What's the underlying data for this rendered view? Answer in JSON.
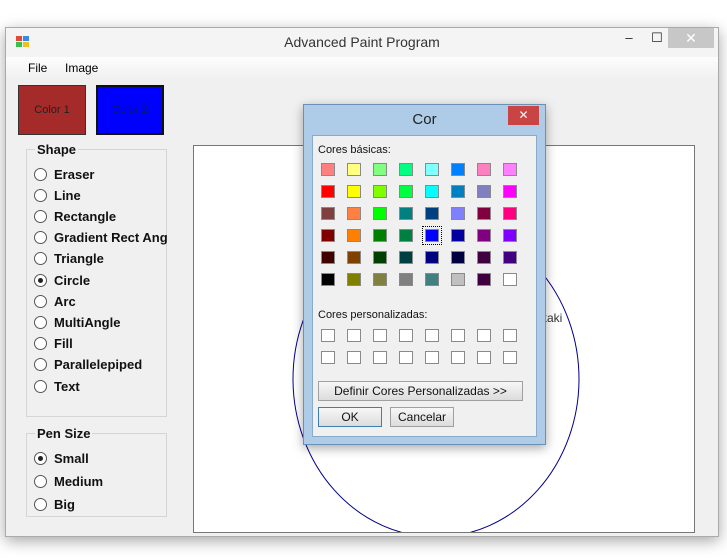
{
  "window": {
    "title": "Advanced Paint Program",
    "minimize_glyph": "–",
    "maximize_glyph": "☐",
    "close_glyph": "✕"
  },
  "menu": [
    "File",
    "Image"
  ],
  "colors": {
    "color1": {
      "label": "Color 1",
      "value": "#a52a2a"
    },
    "color2": {
      "label": "Color 2",
      "value": "#0000ff"
    }
  },
  "shape_group": {
    "title": "Shape",
    "selected": "Circle",
    "options": [
      "Eraser",
      "Line",
      "Rectangle",
      "Gradient Rect Ang",
      "Triangle",
      "Circle",
      "Arc",
      "MultiAngle",
      "Fill",
      "Parallelepiped",
      "Text"
    ]
  },
  "pen_group": {
    "title": "Pen Size",
    "selected": "Small",
    "options": [
      "Small",
      "Medium",
      "Big"
    ]
  },
  "canvas": {
    "text": "kaki",
    "circle_color": "#00008b"
  },
  "color_dialog": {
    "title": "Cor",
    "close_glyph": "✕",
    "basic_label": "Cores básicas:",
    "custom_label": "Cores personalizadas:",
    "define_button": "Definir Cores Personalizadas >>",
    "ok_button": "OK",
    "cancel_button": "Cancelar",
    "selected_index": 28,
    "basic_colors": [
      "#ff8080",
      "#ffff80",
      "#80ff80",
      "#00ff80",
      "#80ffff",
      "#0080ff",
      "#ff80c0",
      "#ff80ff",
      "#ff0000",
      "#ffff00",
      "#80ff00",
      "#00ff40",
      "#00ffff",
      "#0080c0",
      "#8080c0",
      "#ff00ff",
      "#804040",
      "#ff8040",
      "#00ff00",
      "#008080",
      "#004080",
      "#8080ff",
      "#800040",
      "#ff0080",
      "#800000",
      "#ff8000",
      "#008000",
      "#008040",
      "#0000ff",
      "#0000a0",
      "#800080",
      "#8000ff",
      "#400000",
      "#804000",
      "#004000",
      "#004040",
      "#000080",
      "#000040",
      "#400040",
      "#400080",
      "#000000",
      "#808000",
      "#808040",
      "#808080",
      "#408080",
      "#c0c0c0",
      "#400040",
      "#ffffff"
    ],
    "custom_count": 16
  }
}
